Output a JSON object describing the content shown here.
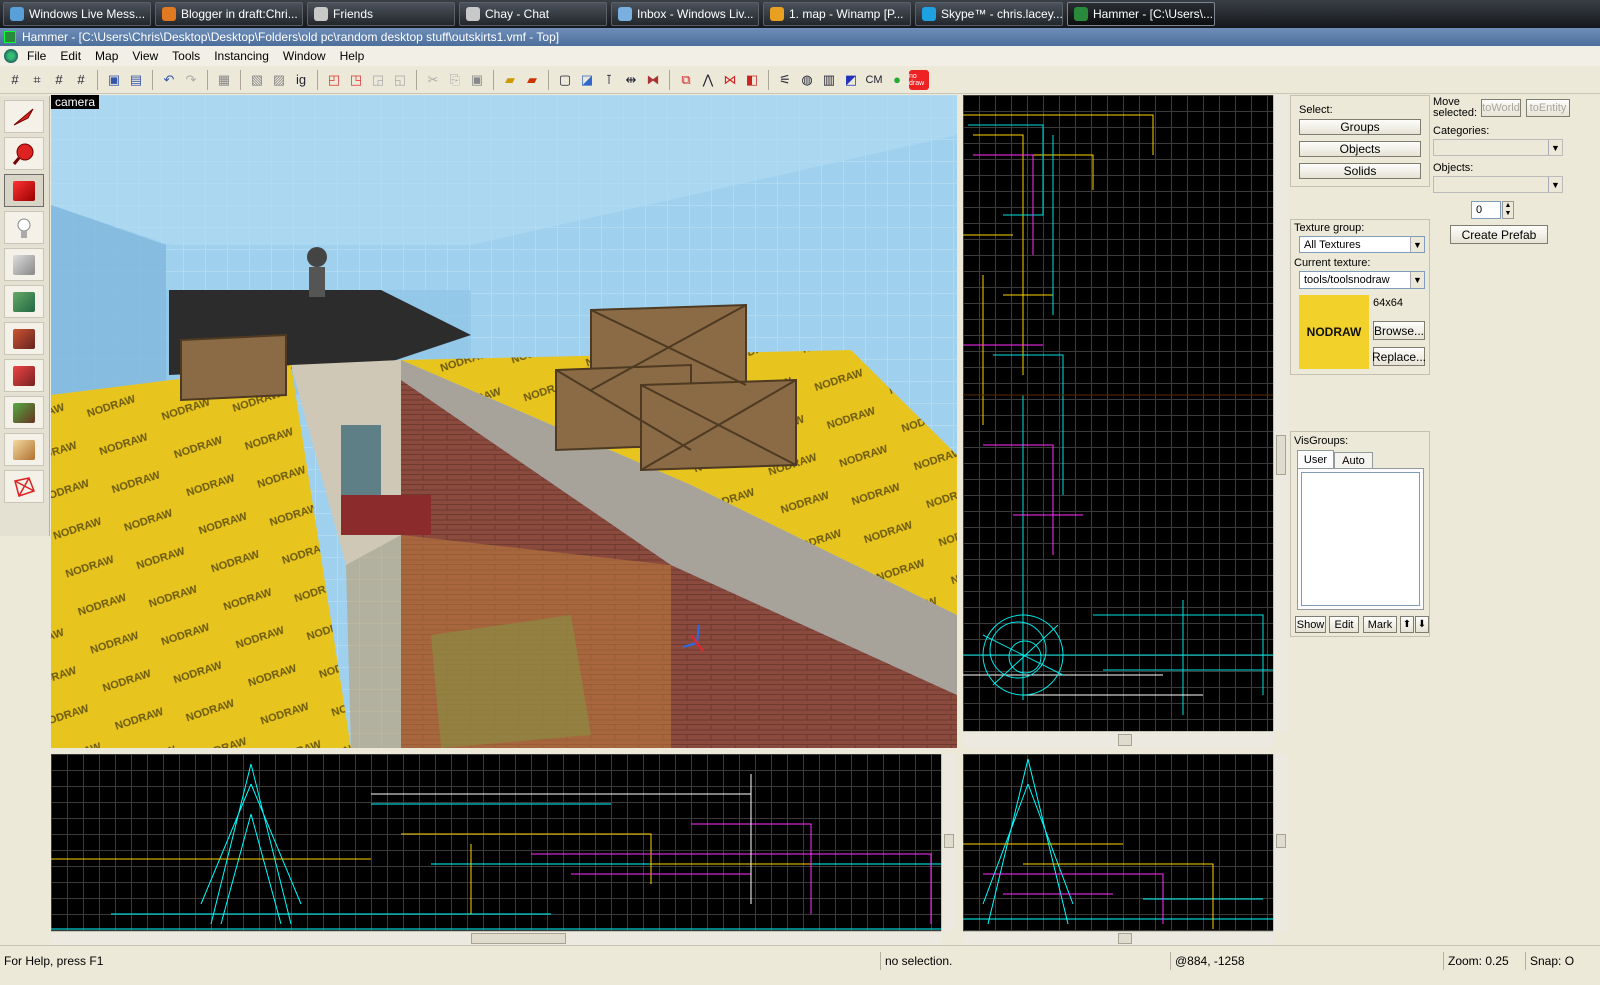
{
  "taskbar": {
    "items": [
      {
        "label": "Windows Live Mess...",
        "icon": "messenger-icon",
        "color": "#5aa0d8"
      },
      {
        "label": "Blogger in draft:Chri...",
        "icon": "firefox-icon",
        "color": "#e07a22"
      },
      {
        "label": "Friends",
        "icon": "steam-icon",
        "color": "#c8c8c8"
      },
      {
        "label": "Chay - Chat",
        "icon": "steam-chat-icon",
        "color": "#c8c8c8"
      },
      {
        "label": "Inbox - Windows Liv...",
        "icon": "mail-icon",
        "color": "#7ab0e0"
      },
      {
        "label": "1. map - Winamp [P...",
        "icon": "winamp-icon",
        "color": "#e8a020"
      },
      {
        "label": "Skype™ - chris.lacey...",
        "icon": "skype-icon",
        "color": "#1da1e0"
      },
      {
        "label": "Hammer - [C:\\Users\\...",
        "icon": "hammer-icon",
        "color": "#2a8a3b"
      }
    ]
  },
  "window": {
    "title": "Hammer - [C:\\Users\\Chris\\Desktop\\Desktop\\Folders\\old pc\\random desktop stuff\\outskirts1.vmf - Top]"
  },
  "menu": [
    "File",
    "Edit",
    "Map",
    "View",
    "Tools",
    "Instancing",
    "Window",
    "Help"
  ],
  "toolbar": {
    "cm_label": "CM",
    "nodraw_label": "no draw"
  },
  "camera": {
    "label": "camera",
    "nodraw_text": "NODRAW"
  },
  "right_panel": {
    "select_label": "Select:",
    "select_buttons": [
      "Groups",
      "Objects",
      "Solids"
    ],
    "move_selected_label": "Move selected:",
    "to_world": "toWorld",
    "to_entity": "toEntity",
    "categories_label": "Categories:",
    "objects_label": "Objects:",
    "count_value": "0",
    "create_prefab": "Create Prefab",
    "texture_group_label": "Texture group:",
    "texture_group_value": "All Textures",
    "current_texture_label": "Current texture:",
    "current_texture_value": "tools/toolsnodraw",
    "texture_size": "64x64",
    "texture_preview_text": "NODRAW",
    "texture_preview_color": "#f2d22a",
    "browse": "Browse...",
    "replace": "Replace...",
    "visgroups_label": "VisGroups:",
    "visgroup_tabs": [
      "User",
      "Auto"
    ],
    "visgroup_buttons": [
      "Show",
      "Edit",
      "Mark"
    ]
  },
  "status": {
    "help": "For Help, press F1",
    "selection": "no selection.",
    "coords": "@884, -1258",
    "zoom": "Zoom: 0.25",
    "snap": "Snap: O"
  }
}
